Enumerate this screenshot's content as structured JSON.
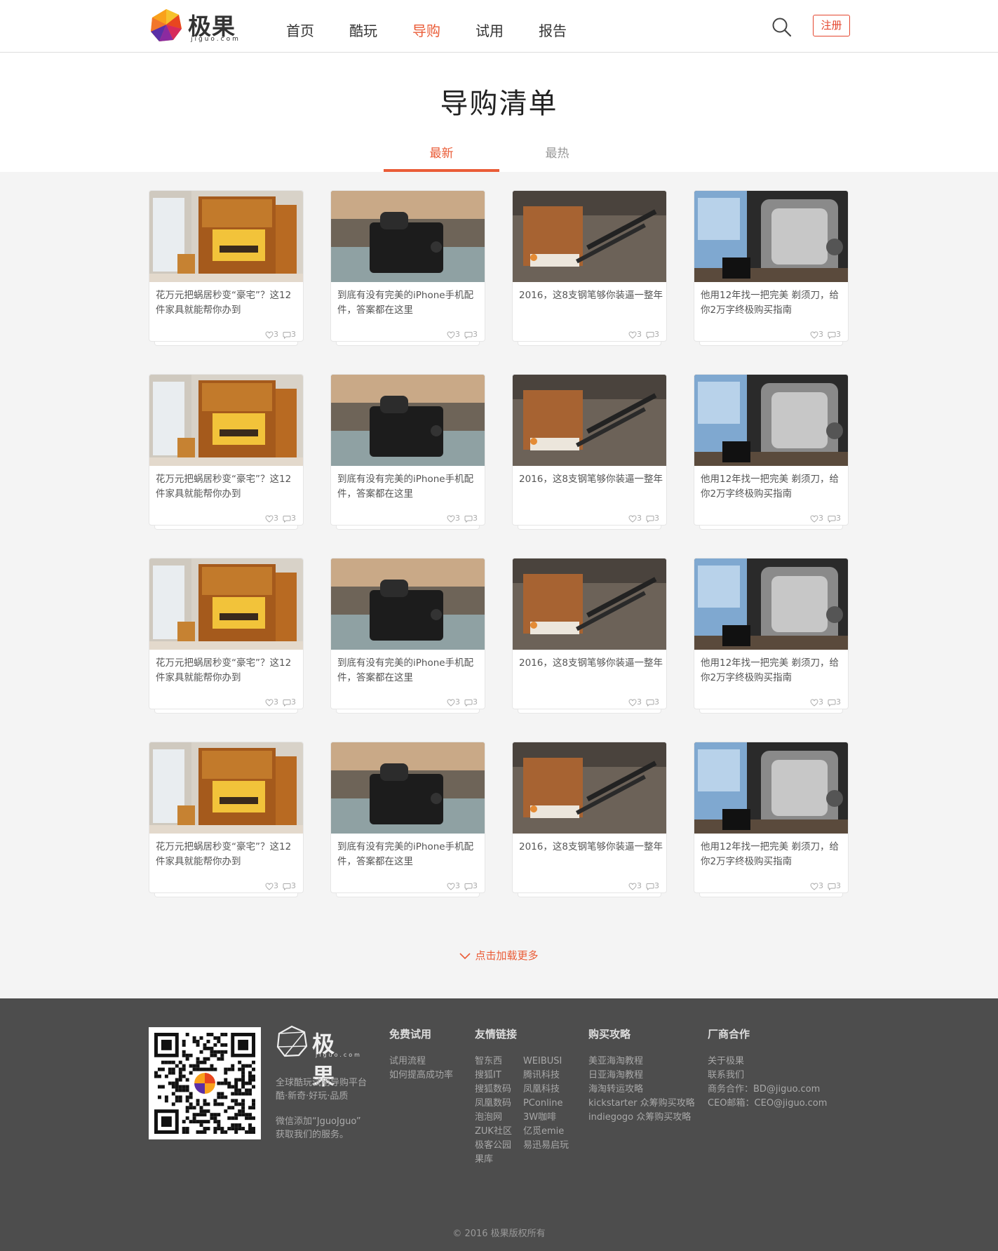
{
  "brand": {
    "logo_text": "极果",
    "logo_sub": "jiguo.com"
  },
  "nav": [
    {
      "label": "首页",
      "active": false
    },
    {
      "label": "酷玩",
      "active": false
    },
    {
      "label": "导购",
      "active": true
    },
    {
      "label": "试用",
      "active": false
    },
    {
      "label": "报告",
      "active": false
    }
  ],
  "header": {
    "search_icon": "search-icon",
    "register_label": "注册"
  },
  "page": {
    "title": "导购清单",
    "tabs": [
      {
        "label": "最新",
        "active": true
      },
      {
        "label": "最热",
        "active": false
      }
    ]
  },
  "cards": [
    {
      "title": "花万元把蜗居秒变“豪宅”？这12件家具就能帮你办到",
      "likes": "3",
      "comments": "3",
      "image": "furniture"
    },
    {
      "title": "到底有没有完美的iPhone手机配件，答案都在这里",
      "likes": "3",
      "comments": "3",
      "image": "phone"
    },
    {
      "title": "2016，这8支钢笔够你装逼一整年",
      "likes": "3",
      "comments": "3",
      "image": "pen"
    },
    {
      "title": "他用12年找一把完美 剃须刀，给你2万字终极购买指南",
      "likes": "3",
      "comments": "3",
      "image": "shaver"
    }
  ],
  "load_more": "点击加载更多",
  "footer": {
    "logo_text": "极果",
    "logo_sub": "jiguo.com",
    "slogan": [
      "全球酷玩试用导购平台",
      "酷·新奇·好玩·品质"
    ],
    "wechat": [
      "微信添加“JguoJguo”",
      "获取我们的服务。"
    ],
    "columns": [
      {
        "title": "免费试用",
        "items": [
          "试用流程",
          "如何提高成功率"
        ]
      },
      {
        "title": "友情链接",
        "items_a": [
          "智东西",
          "搜狐IT",
          "搜狐数码",
          "凤凰数码",
          "泡泡网",
          "ZUK社区",
          "极客公园",
          "果库"
        ],
        "items_b": [
          "WEIBUSI",
          "腾讯科技",
          "凤凰科技",
          "PConline",
          "3W咖啡",
          "亿觅emie",
          "易迅易启玩"
        ]
      },
      {
        "title": "购买攻略",
        "items": [
          "美亚海淘教程",
          "日亚海淘教程",
          "海淘转运攻略",
          "kickstarter 众筹购买攻略",
          "indiegogo 众筹购买攻略"
        ]
      },
      {
        "title": "厂商合作",
        "items": [
          "关于极果",
          "联系我们",
          "商务合作：BD@jiguo.com",
          "CEO邮箱：CEO@jiguo.com"
        ]
      }
    ],
    "copyright": "© 2016 极果版权所有"
  },
  "colors": {
    "accent": "#ea5c37",
    "footer_bg": "#4d4d4d",
    "main_bg": "#f4f4f4"
  }
}
